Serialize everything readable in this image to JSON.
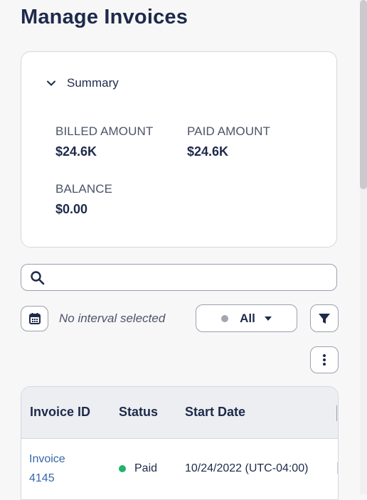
{
  "page": {
    "title": "Manage Invoices"
  },
  "summary": {
    "toggle_label": "Summary",
    "billed_label": "BILLED AMOUNT",
    "billed_value": "$24.6K",
    "paid_label": "PAID AMOUNT",
    "paid_value": "$24.6K",
    "balance_label": "BALANCE",
    "balance_value": "$0.00"
  },
  "search": {
    "value": "",
    "placeholder": ""
  },
  "filters": {
    "interval_text": "No interval selected",
    "status_value": "All"
  },
  "table": {
    "headers": [
      "Invoice ID",
      "Status",
      "Start Date"
    ],
    "rows": [
      {
        "invoice_line1": "Invoice",
        "invoice_line2": "4145",
        "status": "Paid",
        "start_date": "10/24/2022 (UTC-04:00)"
      }
    ]
  },
  "colors": {
    "title": "#1e2a4a",
    "link": "#3567a8",
    "paid_status": "#21b36b",
    "header_bg": "#eceef2"
  },
  "icons": [
    "chevron-down-icon",
    "search-icon",
    "calendar-icon",
    "filter-icon",
    "more-vertical-icon"
  ]
}
